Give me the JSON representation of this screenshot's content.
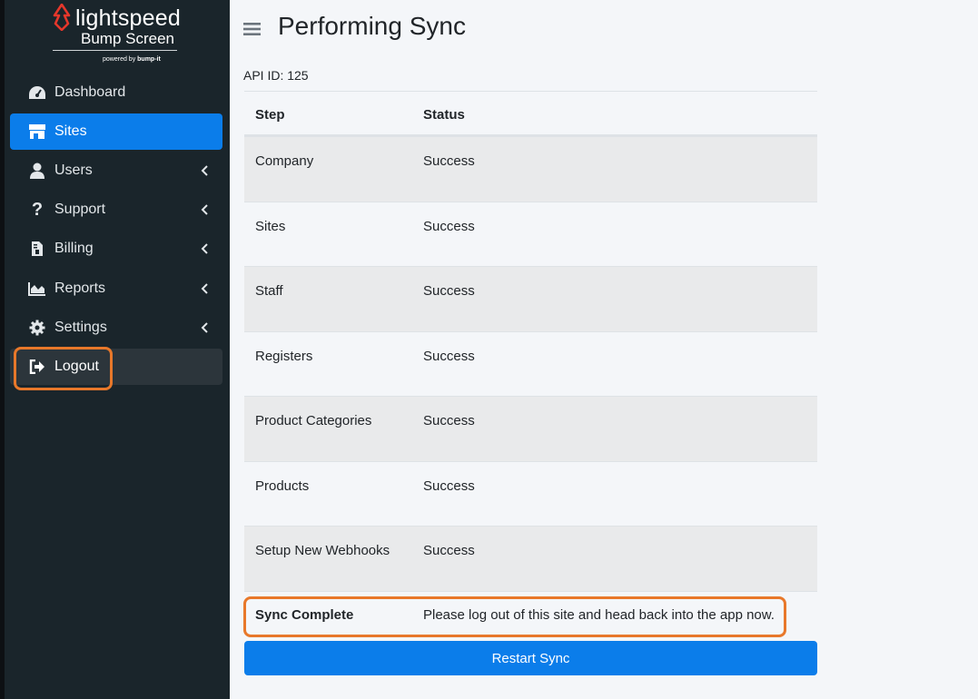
{
  "brand": {
    "name": "lightspeed",
    "product": "Bump Screen",
    "powered_prefix": "powered by ",
    "powered_name": "bump-it"
  },
  "colors": {
    "sidebar_bg": "#1a252b",
    "accent": "#0b7dea",
    "highlight": "#e8782a",
    "brand_red": "#e5372b"
  },
  "sidebar": {
    "items": [
      {
        "label": "Dashboard",
        "icon": "dashboard-gauge-icon",
        "active": false,
        "has_submenu": false
      },
      {
        "label": "Sites",
        "icon": "store-icon",
        "active": true,
        "has_submenu": false
      },
      {
        "label": "Users",
        "icon": "user-icon",
        "active": false,
        "has_submenu": true
      },
      {
        "label": "Support",
        "icon": "question-icon",
        "active": false,
        "has_submenu": true
      },
      {
        "label": "Billing",
        "icon": "invoice-icon",
        "active": false,
        "has_submenu": true
      },
      {
        "label": "Reports",
        "icon": "area-chart-icon",
        "active": false,
        "has_submenu": true
      },
      {
        "label": "Settings",
        "icon": "gear-icon",
        "active": false,
        "has_submenu": true
      },
      {
        "label": "Logout",
        "icon": "sign-out-icon",
        "active": false,
        "has_submenu": false
      }
    ]
  },
  "header": {
    "title": "Performing Sync"
  },
  "api_id": "API ID: 125",
  "table": {
    "columns": [
      "Step",
      "Status"
    ],
    "rows": [
      {
        "step": "Company",
        "status": "Success"
      },
      {
        "step": "Sites",
        "status": "Success"
      },
      {
        "step": "Staff",
        "status": "Success"
      },
      {
        "step": "Registers",
        "status": "Success"
      },
      {
        "step": "Product Categories",
        "status": "Success"
      },
      {
        "step": "Products",
        "status": "Success"
      },
      {
        "step": "Setup New Webhooks",
        "status": "Success"
      }
    ],
    "final": {
      "step": "Sync Complete",
      "status": "Please log out of this site and head back into the app now."
    }
  },
  "restart_button": "Restart Sync"
}
